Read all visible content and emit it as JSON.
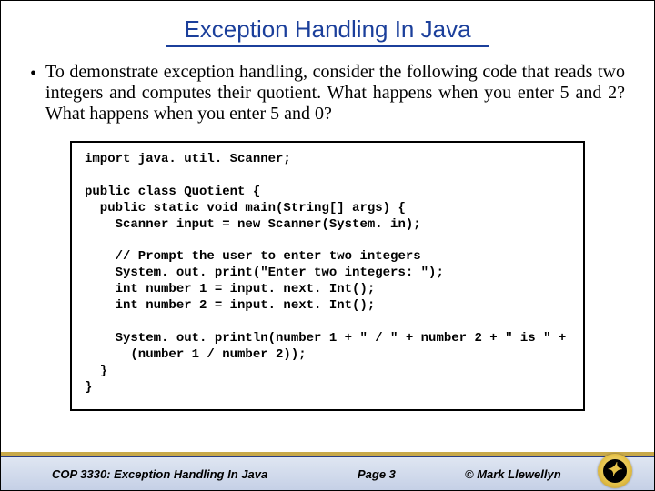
{
  "title": "Exception Handling In Java",
  "bullet_text": "To demonstrate exception handling, consider the following code that reads two integers and computes their quotient.  What happens when you enter 5 and 2? What happens when you enter 5 and 0?",
  "code": "import java. util. Scanner;\n\npublic class Quotient {\n  public static void main(String[] args) {\n    Scanner input = new Scanner(System. in);\n\n    // Prompt the user to enter two integers\n    System. out. print(\"Enter two integers: \");\n    int number 1 = input. next. Int();\n    int number 2 = input. next. Int();\n\n    System. out. println(number 1 + \" / \" + number 2 + \" is \" +\n      (number 1 / number 2));\n  }\n}",
  "footer": {
    "course": "COP 3330: Exception Handling In Java",
    "page": "Page 3",
    "copyright": "© Mark Llewellyn"
  }
}
